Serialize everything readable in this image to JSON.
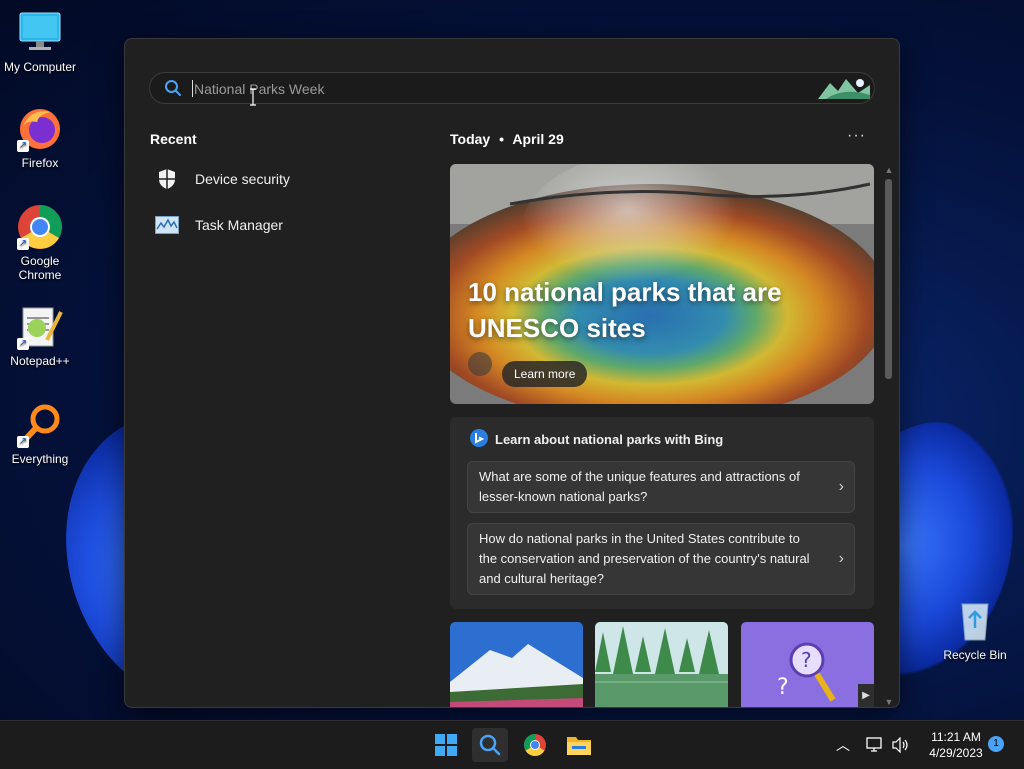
{
  "desktop": {
    "icons": [
      {
        "label": "My Computer",
        "icon": "monitor-icon"
      },
      {
        "label": "Firefox",
        "icon": "firefox-icon"
      },
      {
        "label": "Google Chrome",
        "icon": "chrome-icon"
      },
      {
        "label": "Notepad++",
        "icon": "notepadpp-icon"
      },
      {
        "label": "Everything",
        "icon": "everything-search-icon"
      },
      {
        "label": "Recycle Bin",
        "icon": "recycle-bin-icon"
      }
    ]
  },
  "search": {
    "placeholder": "National Parks Week",
    "value": ""
  },
  "recent": {
    "title": "Recent",
    "items": [
      {
        "label": "Device security",
        "icon": "shield-icon"
      },
      {
        "label": "Task Manager",
        "icon": "task-manager-icon"
      }
    ]
  },
  "today": {
    "heading": "Today",
    "separator": "•",
    "date": "April 29",
    "more": "···"
  },
  "hero": {
    "headline": "10 national parks that are UNESCO sites",
    "cta": "Learn more"
  },
  "bing": {
    "title": "Learn about national parks with Bing",
    "questions": [
      "What are some of the unique features and attractions of lesser-known national parks?",
      "How do national parks in the United States contribute to the conservation and preservation of the country's natural and cultural heritage?"
    ]
  },
  "taskbar": {
    "apps": [
      "start-icon",
      "search-icon",
      "chrome-icon",
      "file-explorer-icon"
    ],
    "time": "11:21 AM",
    "date": "4/29/2023",
    "notifications": "1"
  },
  "colors": {
    "panel": "#202020",
    "card": "#2b2b2b",
    "accent": "#4aa3f5"
  }
}
